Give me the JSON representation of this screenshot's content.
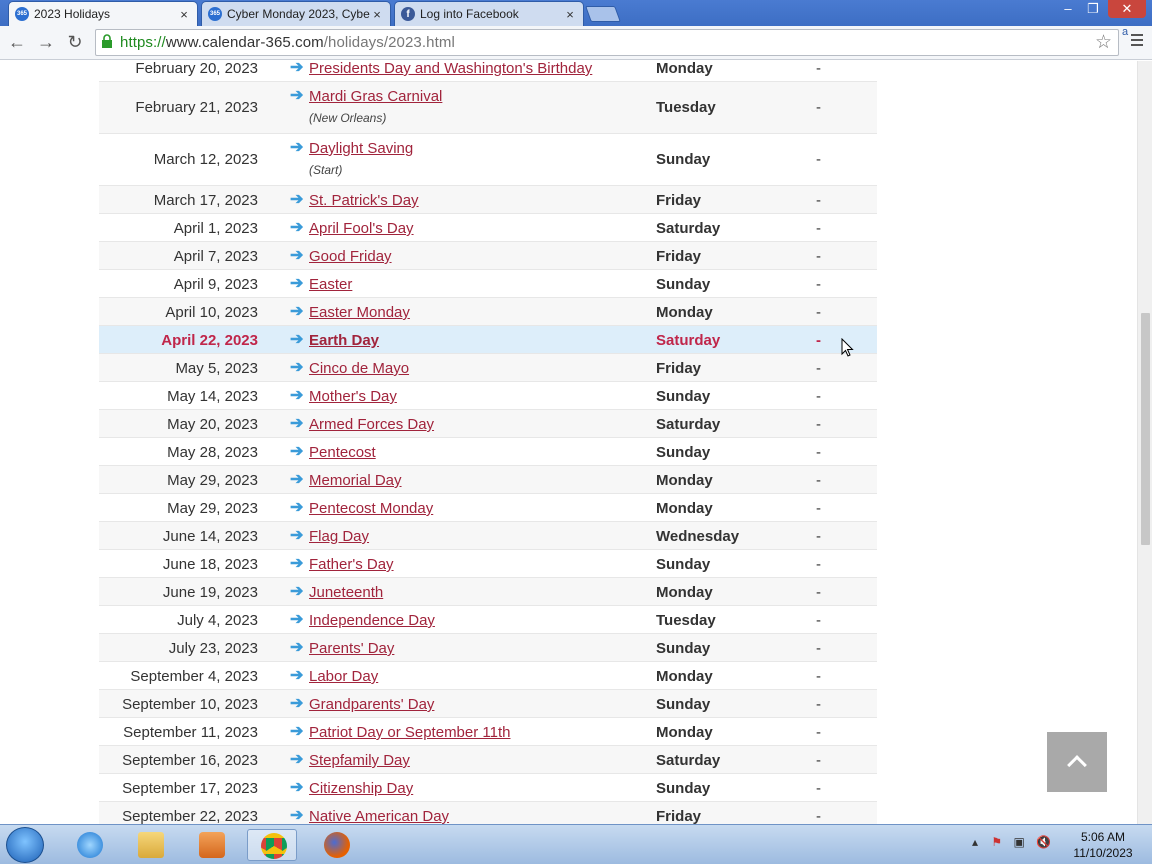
{
  "browser": {
    "tabs": [
      {
        "title": "2023 Holidays",
        "favicon": "calendar-365-icon"
      },
      {
        "title": "Cyber Monday 2023, Cybe",
        "favicon": "calendar-365-icon"
      },
      {
        "title": "Log into Facebook",
        "favicon": "facebook-icon"
      }
    ],
    "close_glyph": "×",
    "url": {
      "scheme": "https://",
      "host": "www.calendar-365.com",
      "path": "/holidays/2023.html"
    }
  },
  "holidays": [
    {
      "date": "February 20, 2023",
      "name": "Presidents Day and Washington's Birthday",
      "note": "",
      "day": "Monday",
      "extra": "-"
    },
    {
      "date": "February 21, 2023",
      "name": "Mardi Gras Carnival ",
      "note": "(New Orleans)",
      "day": "Tuesday",
      "extra": "-"
    },
    {
      "date": "March 12, 2023",
      "name": "Daylight Saving ",
      "note": "(Start)",
      "day": "Sunday",
      "extra": "-"
    },
    {
      "date": "March 17, 2023",
      "name": "St. Patrick's Day",
      "note": "",
      "day": "Friday",
      "extra": "-"
    },
    {
      "date": "April 1, 2023",
      "name": "April Fool's Day",
      "note": "",
      "day": "Saturday",
      "extra": "-"
    },
    {
      "date": "April 7, 2023",
      "name": "Good Friday",
      "note": "",
      "day": "Friday",
      "extra": "-"
    },
    {
      "date": "April 9, 2023",
      "name": "Easter",
      "note": "",
      "day": "Sunday",
      "extra": "-"
    },
    {
      "date": "April 10, 2023",
      "name": "Easter Monday",
      "note": "",
      "day": "Monday",
      "extra": "-"
    },
    {
      "date": "April 22, 2023",
      "name": "Earth Day",
      "note": "",
      "day": "Saturday",
      "extra": "-",
      "highlight": true
    },
    {
      "date": "May 5, 2023",
      "name": "Cinco de Mayo",
      "note": "",
      "day": "Friday",
      "extra": "-"
    },
    {
      "date": "May 14, 2023",
      "name": "Mother's Day",
      "note": "",
      "day": "Sunday",
      "extra": "-"
    },
    {
      "date": "May 20, 2023",
      "name": "Armed Forces Day",
      "note": "",
      "day": "Saturday",
      "extra": "-"
    },
    {
      "date": "May 28, 2023",
      "name": "Pentecost",
      "note": "",
      "day": "Sunday",
      "extra": "-"
    },
    {
      "date": "May 29, 2023",
      "name": "Memorial Day",
      "note": "",
      "day": "Monday",
      "extra": "-"
    },
    {
      "date": "May 29, 2023",
      "name": "Pentecost Monday",
      "note": "",
      "day": "Monday",
      "extra": "-"
    },
    {
      "date": "June 14, 2023",
      "name": "Flag Day",
      "note": "",
      "day": "Wednesday",
      "extra": "-"
    },
    {
      "date": "June 18, 2023",
      "name": "Father's Day",
      "note": "",
      "day": "Sunday",
      "extra": "-"
    },
    {
      "date": "June 19, 2023",
      "name": "Juneteenth",
      "note": "",
      "day": "Monday",
      "extra": "-"
    },
    {
      "date": "July 4, 2023",
      "name": "Independence Day",
      "note": "",
      "day": "Tuesday",
      "extra": "-"
    },
    {
      "date": "July 23, 2023",
      "name": "Parents' Day",
      "note": "",
      "day": "Sunday",
      "extra": "-"
    },
    {
      "date": "September 4, 2023",
      "name": "Labor Day",
      "note": "",
      "day": "Monday",
      "extra": "-"
    },
    {
      "date": "September 10, 2023",
      "name": "Grandparents' Day",
      "note": "",
      "day": "Sunday",
      "extra": "-"
    },
    {
      "date": "September 11, 2023",
      "name": "Patriot Day or September 11th",
      "note": "",
      "day": "Monday",
      "extra": "-"
    },
    {
      "date": "September 16, 2023",
      "name": "Stepfamily Day",
      "note": "",
      "day": "Saturday",
      "extra": "-"
    },
    {
      "date": "September 17, 2023",
      "name": "Citizenship Day",
      "note": "",
      "day": "Sunday",
      "extra": "-"
    },
    {
      "date": "September 22, 2023",
      "name": "Native American Day",
      "note": "",
      "day": "Friday",
      "extra": "-"
    }
  ],
  "taskbar": {
    "time": "5:06 AM",
    "date": "11/10/2023",
    "apps": [
      "internet-explorer-icon",
      "file-explorer-icon",
      "media-player-icon",
      "chrome-icon",
      "firefox-icon"
    ]
  },
  "colors": {
    "link": "#a1243c",
    "highlight_row": "#ddeefa",
    "highlight_text": "#c0264a",
    "arrow": "#3a9bd9"
  }
}
